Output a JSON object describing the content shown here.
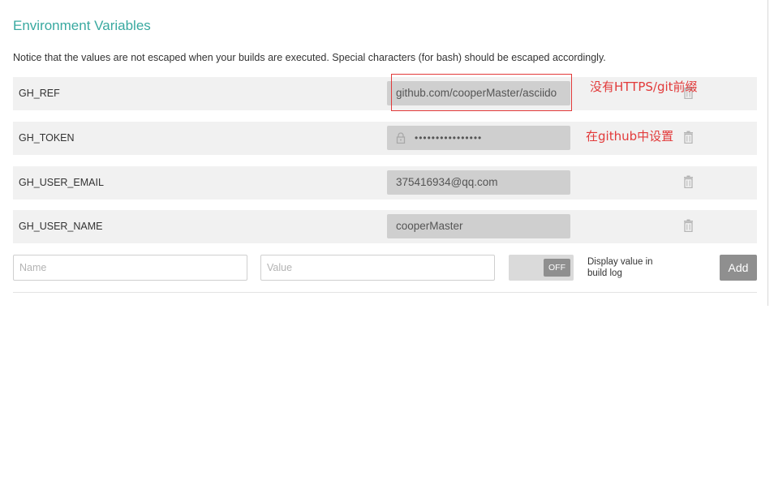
{
  "section": {
    "title": "Environment Variables",
    "notice": "Notice that the values are not escaped when your builds are executed. Special characters (for bash) should be escaped accordingly."
  },
  "variables": [
    {
      "name": "GH_REF",
      "value": "github.com/cooperMaster/asciido",
      "secure": false
    },
    {
      "name": "GH_TOKEN",
      "value": "••••••••••••••••",
      "secure": true
    },
    {
      "name": "GH_USER_EMAIL",
      "value": "375416934@qq.com",
      "secure": false
    },
    {
      "name": "GH_USER_NAME",
      "value": "cooperMaster",
      "secure": false
    }
  ],
  "new_var": {
    "name_placeholder": "Name",
    "value_placeholder": "Value",
    "toggle_state": "OFF",
    "display_label": "Display value in build log",
    "add_label": "Add"
  },
  "annotations": {
    "ref_note": "没有HTTPS/git前缀",
    "token_note": "在github中设置",
    "color": "#e23a3a"
  },
  "icons": [
    "trash-icon",
    "lock-icon"
  ],
  "colors": {
    "accent": "#39a9a0",
    "row_bg": "#f1f1f1",
    "value_bg": "#cfcfcf",
    "button_bg": "#8f8f8f"
  }
}
